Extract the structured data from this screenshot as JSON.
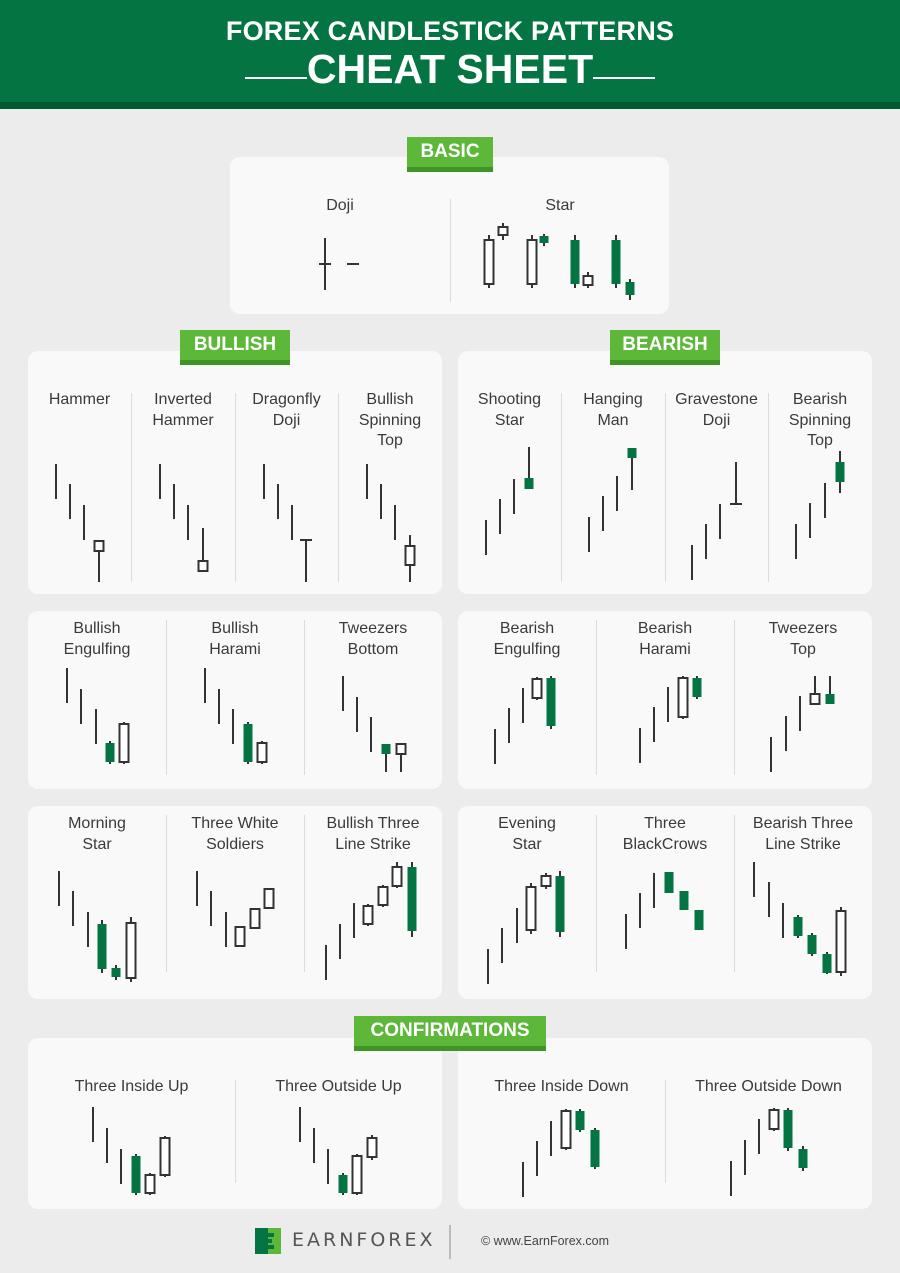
{
  "header": {
    "title_line1": "FOREX CANDLESTICK PATTERNS",
    "title_line2": "CHEAT SHEET"
  },
  "colors": {
    "header_green": "#047442",
    "tag_green": "#5db83a",
    "bear_candle": "#037442",
    "bull_candle_outline": "#333333",
    "wick": "#333333"
  },
  "sections": {
    "basic": "BASIC",
    "bullish": "BULLISH",
    "bearish": "BEARISH",
    "confirmations": "CONFIRMATIONS"
  },
  "patterns": {
    "doji": {
      "label": "Doji",
      "candles": [
        {
          "type": "doji",
          "high": 52,
          "low": 0,
          "open": 26,
          "close": 26
        },
        {
          "type": "doji",
          "high": 26,
          "low": 26,
          "open": 26,
          "close": 26
        }
      ]
    },
    "star": {
      "label": "Star",
      "candles": [
        {
          "type": "bull",
          "high": 53,
          "low": 0,
          "open": 4,
          "close": 48
        },
        {
          "type": "bull",
          "high": 65,
          "low": 48,
          "open": 53,
          "close": 61
        },
        {
          "type": "gap",
          "high": 0,
          "low": 0,
          "open": 0,
          "close": 0
        },
        {
          "type": "bull",
          "high": 53,
          "low": 0,
          "open": 4,
          "close": 48
        },
        {
          "type": "bear",
          "high": 54,
          "low": 42,
          "open": 52,
          "close": 45
        },
        {
          "type": "gap",
          "high": 0,
          "low": 0,
          "open": 0,
          "close": 0
        },
        {
          "type": "bear",
          "high": 53,
          "low": 0,
          "open": 48,
          "close": 4
        },
        {
          "type": "bull",
          "high": 16,
          "low": 0,
          "open": 3,
          "close": 12
        },
        {
          "type": "gap",
          "high": 0,
          "low": 0,
          "open": 0,
          "close": 0
        },
        {
          "type": "bear",
          "high": 53,
          "low": 0,
          "open": 48,
          "close": 4
        },
        {
          "type": "bear",
          "high": 9,
          "low": -12,
          "open": 6,
          "close": -7
        }
      ]
    },
    "hammer": {
      "label": "Hammer",
      "candles": [
        {
          "type": "line",
          "high": 118,
          "low": 83
        },
        {
          "type": "line",
          "high": 98,
          "low": 63
        },
        {
          "type": "line",
          "high": 77,
          "low": 42
        },
        {
          "type": "bull",
          "high": 41,
          "low": 0,
          "open": 31,
          "close": 41
        }
      ]
    },
    "inverted_hammer": {
      "label": "Inverted\nHammer",
      "candles": [
        {
          "type": "line",
          "high": 118,
          "low": 83
        },
        {
          "type": "line",
          "high": 98,
          "low": 63
        },
        {
          "type": "line",
          "high": 77,
          "low": 42
        },
        {
          "type": "bull",
          "high": 54,
          "low": 11,
          "open": 11,
          "close": 21
        }
      ]
    },
    "dragonfly_doji": {
      "label": "Dragonfly\nDoji",
      "candles": [
        {
          "type": "line",
          "high": 118,
          "low": 83
        },
        {
          "type": "line",
          "high": 98,
          "low": 63
        },
        {
          "type": "line",
          "high": 77,
          "low": 42
        },
        {
          "type": "doji",
          "high": 42,
          "low": 0,
          "open": 42,
          "close": 42
        }
      ]
    },
    "bullish_spinning_top": {
      "label": "Bullish\nSpinning\nTop",
      "candles": [
        {
          "type": "line",
          "high": 118,
          "low": 83
        },
        {
          "type": "line",
          "high": 98,
          "low": 63
        },
        {
          "type": "line",
          "high": 77,
          "low": 42
        },
        {
          "type": "bull",
          "high": 47,
          "low": 0,
          "open": 17,
          "close": 36
        }
      ]
    },
    "shooting_star": {
      "label": "Shooting\nStar",
      "candles": [
        {
          "type": "line",
          "high": 52,
          "low": 17
        },
        {
          "type": "line",
          "high": 73,
          "low": 38
        },
        {
          "type": "line",
          "high": 93,
          "low": 58
        },
        {
          "type": "bear",
          "high": 125,
          "low": 83,
          "open": 94,
          "close": 83
        }
      ]
    },
    "hanging_man": {
      "label": "Hanging\nMan",
      "candles": [
        {
          "type": "line",
          "high": 55,
          "low": 20
        },
        {
          "type": "line",
          "high": 76,
          "low": 41
        },
        {
          "type": "line",
          "high": 96,
          "low": 61
        },
        {
          "type": "bear",
          "high": 124,
          "low": 82,
          "open": 124,
          "close": 114
        }
      ]
    },
    "gravestone_doji": {
      "label": "Gravestone\nDoji",
      "candles": [
        {
          "type": "line",
          "high": 41,
          "low": 6
        },
        {
          "type": "line",
          "high": 62,
          "low": 27
        },
        {
          "type": "line",
          "high": 82,
          "low": 47
        },
        {
          "type": "doji",
          "high": 124,
          "low": 82,
          "open": 82,
          "close": 82
        }
      ]
    },
    "bearish_spinning_top": {
      "label": "Bearish\nSpinning\nTop",
      "candles": [
        {
          "type": "line",
          "high": 51,
          "low": 16
        },
        {
          "type": "line",
          "high": 72,
          "low": 37
        },
        {
          "type": "line",
          "high": 92,
          "low": 57
        },
        {
          "type": "bear",
          "high": 124,
          "low": 82,
          "open": 113,
          "close": 93
        }
      ]
    },
    "bullish_engulfing": {
      "label": "Bullish\nEngulfing",
      "candles": [
        {
          "type": "line",
          "high": 96,
          "low": 61
        },
        {
          "type": "line",
          "high": 75,
          "low": 40
        },
        {
          "type": "line",
          "high": 55,
          "low": 20
        },
        {
          "type": "bear",
          "high": 23,
          "low": 0,
          "open": 21,
          "close": 2
        },
        {
          "type": "bull",
          "high": 42,
          "low": 0,
          "open": 2,
          "close": 40
        }
      ]
    },
    "bullish_harami": {
      "label": "Bullish\nHarami",
      "candles": [
        {
          "type": "line",
          "high": 96,
          "low": 61
        },
        {
          "type": "line",
          "high": 75,
          "low": 40
        },
        {
          "type": "line",
          "high": 55,
          "low": 20
        },
        {
          "type": "bear",
          "high": 42,
          "low": 0,
          "open": 40,
          "close": 2
        },
        {
          "type": "bull",
          "high": 23,
          "low": 0,
          "open": 2,
          "close": 21
        }
      ]
    },
    "tweezers_bottom": {
      "label": "Tweezers\nBottom",
      "candles": [
        {
          "type": "line",
          "high": 96,
          "low": 61
        },
        {
          "type": "line",
          "high": 75,
          "low": 40
        },
        {
          "type": "line",
          "high": 55,
          "low": 20
        },
        {
          "type": "bear",
          "high": 28,
          "low": 0,
          "open": 28,
          "close": 18
        },
        {
          "type": "bull",
          "high": 28,
          "low": 0,
          "open": 18,
          "close": 28
        }
      ]
    },
    "bearish_engulfing": {
      "label": "Bearish\nEngulfing",
      "candles": [
        {
          "type": "line",
          "high": 35,
          "low": 0
        },
        {
          "type": "line",
          "high": 56,
          "low": 21
        },
        {
          "type": "line",
          "high": 76,
          "low": 41
        },
        {
          "type": "bull",
          "high": 87,
          "low": 64,
          "open": 66,
          "close": 85
        },
        {
          "type": "bear",
          "high": 88,
          "low": 35,
          "open": 86,
          "close": 38
        }
      ]
    },
    "bearish_harami": {
      "label": "Bearish\nHarami",
      "candles": [
        {
          "type": "line",
          "high": 36,
          "low": 1
        },
        {
          "type": "line",
          "high": 57,
          "low": 22
        },
        {
          "type": "line",
          "high": 77,
          "low": 42
        },
        {
          "type": "bull",
          "high": 88,
          "low": 45,
          "open": 47,
          "close": 86
        },
        {
          "type": "bear",
          "high": 88,
          "low": 65,
          "open": 86,
          "close": 67
        }
      ]
    },
    "tweezers_top": {
      "label": "Tweezers\nTop",
      "candles": [
        {
          "type": "line",
          "high": 35,
          "low": 0
        },
        {
          "type": "line",
          "high": 56,
          "low": 21
        },
        {
          "type": "line",
          "high": 76,
          "low": 41
        },
        {
          "type": "bull",
          "high": 96,
          "low": 68,
          "open": 68,
          "close": 78
        },
        {
          "type": "bear",
          "high": 96,
          "low": 68,
          "open": 78,
          "close": 68
        }
      ]
    },
    "morning_star": {
      "label": "Morning\nStar",
      "candles": [
        {
          "type": "line",
          "high": 115,
          "low": 80
        },
        {
          "type": "line",
          "high": 95,
          "low": 60
        },
        {
          "type": "line",
          "high": 74,
          "low": 39
        },
        {
          "type": "bear",
          "high": 66,
          "low": 13,
          "open": 62,
          "close": 17
        },
        {
          "type": "bear",
          "high": 21,
          "low": 6,
          "open": 18,
          "close": 9
        },
        {
          "type": "bull",
          "high": 69,
          "low": 4,
          "open": 8,
          "close": 63
        }
      ]
    },
    "three_white_soldiers": {
      "label": "Three White\nSoldiers",
      "candles": [
        {
          "type": "line",
          "high": 115,
          "low": 80
        },
        {
          "type": "line",
          "high": 95,
          "low": 60
        },
        {
          "type": "line",
          "high": 74,
          "low": 39
        },
        {
          "type": "bull",
          "high": 59,
          "low": 40,
          "open": 40,
          "close": 59
        },
        {
          "type": "bull",
          "high": 77,
          "low": 58,
          "open": 58,
          "close": 77
        },
        {
          "type": "bull",
          "high": 97,
          "low": 78,
          "open": 78,
          "close": 97
        }
      ]
    },
    "bullish_three_line_strike": {
      "label": "Bullish Three\nLine Strike",
      "candles": [
        {
          "type": "line",
          "high": 35,
          "low": 0
        },
        {
          "type": "line",
          "high": 56,
          "low": 21
        },
        {
          "type": "line",
          "high": 77,
          "low": 42
        },
        {
          "type": "bull",
          "high": 76,
          "low": 54,
          "open": 56,
          "close": 74
        },
        {
          "type": "bull",
          "high": 95,
          "low": 73,
          "open": 75,
          "close": 93
        },
        {
          "type": "bull",
          "high": 118,
          "low": 92,
          "open": 94,
          "close": 113
        },
        {
          "type": "bear",
          "high": 118,
          "low": 43,
          "open": 113,
          "close": 49
        }
      ]
    },
    "evening_star": {
      "label": "Evening\nStar",
      "candles": [
        {
          "type": "line",
          "high": 35,
          "low": 0
        },
        {
          "type": "line",
          "high": 56,
          "low": 21
        },
        {
          "type": "line",
          "high": 76,
          "low": 41
        },
        {
          "type": "bull",
          "high": 101,
          "low": 50,
          "open": 54,
          "close": 97
        },
        {
          "type": "bull",
          "high": 111,
          "low": 95,
          "open": 98,
          "close": 108
        },
        {
          "type": "bear",
          "high": 113,
          "low": 47,
          "open": 108,
          "close": 52
        }
      ]
    },
    "three_black_crows": {
      "label": "Three\nBlackCrows",
      "candles": [
        {
          "type": "line",
          "high": 70,
          "low": 35
        },
        {
          "type": "line",
          "high": 91,
          "low": 56
        },
        {
          "type": "line",
          "high": 111,
          "low": 76
        },
        {
          "type": "bear",
          "high": 112,
          "low": 91,
          "open": 112,
          "close": 91
        },
        {
          "type": "bear",
          "high": 93,
          "low": 74,
          "open": 93,
          "close": 74
        },
        {
          "type": "bear",
          "high": 74,
          "low": 54,
          "open": 74,
          "close": 54
        }
      ]
    },
    "bearish_three_line_strike": {
      "label": "Bearish Three\nLine Strike",
      "candles": [
        {
          "type": "line",
          "high": 118,
          "low": 83
        },
        {
          "type": "line",
          "high": 98,
          "low": 63
        },
        {
          "type": "line",
          "high": 77,
          "low": 42
        },
        {
          "type": "bear",
          "high": 65,
          "low": 42,
          "open": 63,
          "close": 44
        },
        {
          "type": "bear",
          "high": 47,
          "low": 24,
          "open": 45,
          "close": 26
        },
        {
          "type": "bear",
          "high": 28,
          "low": 6,
          "open": 26,
          "close": 7
        },
        {
          "type": "bull",
          "high": 73,
          "low": 4,
          "open": 8,
          "close": 69
        }
      ]
    },
    "three_inside_up": {
      "label": "Three Inside Up",
      "candles": [
        {
          "type": "line",
          "high": 88,
          "low": 53
        },
        {
          "type": "line",
          "high": 67,
          "low": 32
        },
        {
          "type": "line",
          "high": 46,
          "low": 11
        },
        {
          "type": "bear",
          "high": 41,
          "low": 0,
          "open": 39,
          "close": 2
        },
        {
          "type": "bull",
          "high": 22,
          "low": 0,
          "open": 2,
          "close": 20
        },
        {
          "type": "bull",
          "high": 59,
          "low": 18,
          "open": 20,
          "close": 57
        }
      ]
    },
    "three_outside_up": {
      "label": "Three Outside Up",
      "candles": [
        {
          "type": "line",
          "high": 88,
          "low": 53
        },
        {
          "type": "line",
          "high": 67,
          "low": 32
        },
        {
          "type": "line",
          "high": 46,
          "low": 11
        },
        {
          "type": "bear",
          "high": 22,
          "low": 0,
          "open": 20,
          "close": 2
        },
        {
          "type": "bull",
          "high": 41,
          "low": 0,
          "open": 2,
          "close": 39
        },
        {
          "type": "bull",
          "high": 60,
          "low": 35,
          "open": 38,
          "close": 57
        }
      ]
    },
    "three_inside_down": {
      "label": "Three Inside Down",
      "candles": [
        {
          "type": "line",
          "high": 35,
          "low": 0
        },
        {
          "type": "line",
          "high": 56,
          "low": 21
        },
        {
          "type": "line",
          "high": 76,
          "low": 41
        },
        {
          "type": "bull",
          "high": 88,
          "low": 47,
          "open": 49,
          "close": 86
        },
        {
          "type": "bear",
          "high": 88,
          "low": 65,
          "open": 86,
          "close": 67
        },
        {
          "type": "bear",
          "high": 69,
          "low": 28,
          "open": 67,
          "close": 30
        }
      ]
    },
    "three_outside_down": {
      "label": "Three Outside Down",
      "candles": [
        {
          "type": "line",
          "high": 35,
          "low": 0
        },
        {
          "type": "line",
          "high": 56,
          "low": 21
        },
        {
          "type": "line",
          "high": 77,
          "low": 42
        },
        {
          "type": "bull",
          "high": 88,
          "low": 65,
          "open": 67,
          "close": 86
        },
        {
          "type": "bear",
          "high": 88,
          "low": 45,
          "open": 86,
          "close": 48
        },
        {
          "type": "bear",
          "high": 50,
          "low": 25,
          "open": 47,
          "close": 28
        }
      ]
    }
  },
  "footer": {
    "brand": "EARNFOREX",
    "copyright": "© www.EarnForex.com"
  }
}
